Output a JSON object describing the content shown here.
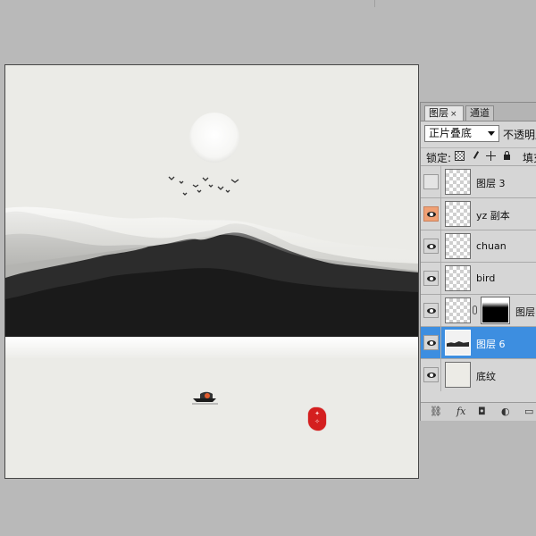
{
  "layers_panel": {
    "tabs": [
      {
        "label": "图层",
        "close": "×"
      },
      {
        "label": "通道"
      }
    ],
    "blend_mode": "正片叠底",
    "opacity_label": "不透明度",
    "lock_label": "锁定:",
    "fill_label": "填充",
    "layers": [
      {
        "name": "图层 3",
        "visible": false
      },
      {
        "name": "yz 副本",
        "visible": true
      },
      {
        "name": "chuan",
        "visible": true
      },
      {
        "name": "bird",
        "visible": true
      },
      {
        "name": "图层",
        "visible": true,
        "has_mask": true
      },
      {
        "name": "图层 6",
        "visible": true,
        "selected": true
      },
      {
        "name": "底纹",
        "visible": true
      }
    ],
    "footer_icons": [
      "link-icon",
      "fx-icon",
      "mask-icon",
      "adjustment-icon",
      "folder-icon"
    ]
  },
  "colors": {
    "workspace": "#b9b9b9",
    "canvas_bg": "#ebebe7",
    "selected_layer": "#3d8ee0",
    "eye_highlight": "#f0a074",
    "seal_red": "#d41f1f"
  }
}
